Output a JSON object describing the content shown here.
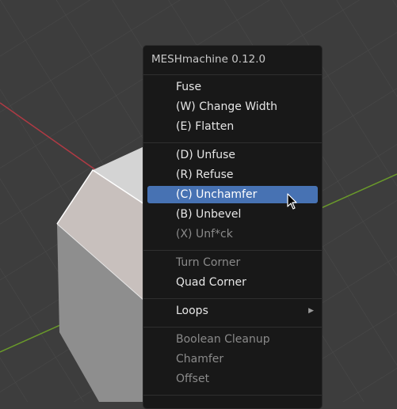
{
  "menu": {
    "title": "MESHmachine 0.12.0",
    "items": [
      {
        "label": "Fuse",
        "disabled": false
      },
      {
        "label": "(W) Change Width",
        "disabled": false
      },
      {
        "label": "(E) Flatten",
        "disabled": false
      },
      {
        "label": "(D) Unfuse",
        "disabled": false
      },
      {
        "label": "(R) Refuse",
        "disabled": false
      },
      {
        "label": "(C) Unchamfer",
        "disabled": false,
        "highlighted": true
      },
      {
        "label": "(B) Unbevel",
        "disabled": false
      },
      {
        "label": "(X) Unf*ck",
        "disabled": true
      },
      {
        "label": "Turn Corner",
        "disabled": true
      },
      {
        "label": "Quad Corner",
        "disabled": false
      },
      {
        "label": "Loops",
        "disabled": false,
        "submenu": true
      },
      {
        "label": "Boolean Cleanup",
        "disabled": true
      },
      {
        "label": "Chamfer",
        "disabled": true
      },
      {
        "label": "Offset",
        "disabled": true
      }
    ]
  },
  "colors": {
    "menu_bg": "#181818",
    "highlight": "#4772b3",
    "viewport_bg": "#3d3d3d",
    "axis_x": "#b03a44",
    "axis_y": "#6a9a2a"
  },
  "icons": {
    "submenu": "triangle-right-icon",
    "cursor": "mouse-pointer-icon"
  }
}
